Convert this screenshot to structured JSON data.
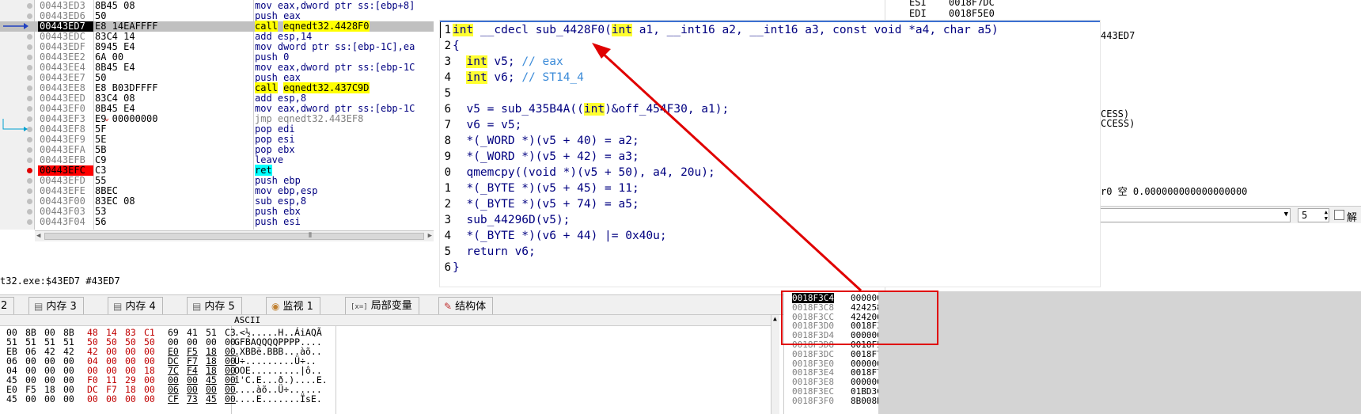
{
  "disasm": {
    "rows": [
      {
        "addr": "00443ED3",
        "bytes": "8B45 08",
        "op": "mov",
        "args": "eax,dword ptr ss:[ebp+8]",
        "kind": "mov"
      },
      {
        "addr": "00443ED6",
        "bytes": "50",
        "op": "push",
        "args": "eax",
        "kind": "push"
      },
      {
        "addr": "00443ED7",
        "bytes": "E8 14EAFFFF",
        "op": "call",
        "args": "eqnedt32.4428F0",
        "kind": "call",
        "current": true
      },
      {
        "addr": "00443EDC",
        "bytes": "83C4 14",
        "op": "add",
        "args": "esp,14",
        "kind": "add"
      },
      {
        "addr": "00443EDF",
        "bytes": "8945 E4",
        "op": "mov",
        "args": "dword ptr ss:[ebp-1C],ea",
        "kind": "mov"
      },
      {
        "addr": "00443EE2",
        "bytes": "6A 00",
        "op": "push",
        "args": "0",
        "kind": "push"
      },
      {
        "addr": "00443EE4",
        "bytes": "8B45 E4",
        "op": "mov",
        "args": "eax,dword ptr ss:[ebp-1C",
        "kind": "mov"
      },
      {
        "addr": "00443EE7",
        "bytes": "50",
        "op": "push",
        "args": "eax",
        "kind": "push"
      },
      {
        "addr": "00443EE8",
        "bytes": "E8 B03DFFFF",
        "op": "call",
        "args": "eqnedt32.437C9D",
        "kind": "call"
      },
      {
        "addr": "00443EED",
        "bytes": "83C4 08",
        "op": "add",
        "args": "esp,8",
        "kind": "add"
      },
      {
        "addr": "00443EF0",
        "bytes": "8B45 E4",
        "op": "mov",
        "args": "eax,dword ptr ss:[ebp-1C",
        "kind": "mov"
      },
      {
        "addr": "00443EF3",
        "bytes": "E9 00000000",
        "op": "jmp",
        "args": "eqnedt32.443EF8",
        "kind": "jmp"
      },
      {
        "addr": "00443EF8",
        "bytes": "5F",
        "op": "pop",
        "args": "edi",
        "kind": "pop"
      },
      {
        "addr": "00443EF9",
        "bytes": "5E",
        "op": "pop",
        "args": "esi",
        "kind": "pop"
      },
      {
        "addr": "00443EFA",
        "bytes": "5B",
        "op": "pop",
        "args": "ebx",
        "kind": "pop"
      },
      {
        "addr": "00443EFB",
        "bytes": "C9",
        "op": "leave",
        "args": "",
        "kind": "leave"
      },
      {
        "addr": "00443EFC",
        "bytes": "C3",
        "op": "ret",
        "args": "",
        "kind": "ret",
        "breakpoint": true
      },
      {
        "addr": "00443EFD",
        "bytes": "55",
        "op": "push",
        "args": "ebp",
        "kind": "push"
      },
      {
        "addr": "00443EFE",
        "bytes": "8BEC",
        "op": "mov",
        "args": "ebp,esp",
        "kind": "mov"
      },
      {
        "addr": "00443F00",
        "bytes": "83EC 08",
        "op": "sub",
        "args": "esp,8",
        "kind": "sub"
      },
      {
        "addr": "00443F03",
        "bytes": "53",
        "op": "push",
        "args": "ebx",
        "kind": "push"
      },
      {
        "addr": "00443F04",
        "bytes": "56",
        "op": "push",
        "args": "esi",
        "kind": "push"
      }
    ],
    "path_text": "t32.exe:$43ED7 #43ED7"
  },
  "registers": {
    "esi_label": "ESI",
    "esi_value": "0018F7DC",
    "edi_label": "EDI",
    "edi_value": "0018F5E0",
    "ref_addr": "443ED7",
    "access1": "CESS)",
    "access2": "CCESS)",
    "fpu_line": "r0 空 0.000000000000000000",
    "spin_value": "5",
    "check_label": "解"
  },
  "tabs": [
    {
      "label": "2",
      "icon": ""
    },
    {
      "label": "内存 3",
      "icon": "memory-icon"
    },
    {
      "label": "内存 4",
      "icon": "memory-icon"
    },
    {
      "label": "内存 5",
      "icon": "memory-icon"
    },
    {
      "label": "监视 1",
      "icon": "watch-icon"
    },
    {
      "label": "局部变量",
      "icon": "locals-icon"
    },
    {
      "label": "结构体",
      "icon": "struct-icon"
    }
  ],
  "dump": {
    "ascii_header": "ASCII",
    "rows": [
      {
        "hex": [
          "00",
          "8B",
          "00",
          "8B",
          "48",
          "14",
          "83",
          "C1",
          "69",
          "41",
          "51",
          "C3"
        ],
        "ascii": ".<½.....H..ÁiAQÃ"
      },
      {
        "hex": [
          "51",
          "51",
          "51",
          "51",
          "50",
          "50",
          "50",
          "50",
          "00",
          "00",
          "00",
          "00"
        ],
        "ascii": "GFBAQQQQPPPP...."
      },
      {
        "hex": [
          "EB",
          "06",
          "42",
          "42",
          "42",
          "00",
          "00",
          "00",
          "E0",
          "F5",
          "18",
          "00"
        ],
        "ascii": ".XBBë.BBB...àõ.."
      },
      {
        "hex": [
          "06",
          "00",
          "00",
          "00",
          "04",
          "00",
          "00",
          "00",
          "DC",
          "F7",
          "18",
          "00"
        ],
        "ascii": "Ü÷.........Ü÷.."
      },
      {
        "hex": [
          "04",
          "00",
          "00",
          "00",
          "00",
          "00",
          "00",
          "18",
          "7C",
          "F4",
          "18",
          "00"
        ],
        "ascii": "OOE.........|ô.."
      },
      {
        "hex": [
          "45",
          "00",
          "00",
          "00",
          "F0",
          "11",
          "29",
          "00",
          "00",
          "00",
          "45",
          "00"
        ],
        "ascii": "î'C.E...ð.)....E."
      },
      {
        "hex": [
          "E0",
          "F5",
          "18",
          "00",
          "DC",
          "F7",
          "18",
          "00",
          "06",
          "00",
          "00",
          "00"
        ],
        "ascii": "....àõ..Ü÷......"
      },
      {
        "hex": [
          "45",
          "00",
          "00",
          "00",
          "00",
          "00",
          "00",
          "00",
          "CF",
          "73",
          "45",
          "00"
        ],
        "ascii": "....E.......ÏsE."
      }
    ]
  },
  "stack": {
    "rows": [
      {
        "addr": "0018F3C4",
        "value": "00000000",
        "top": true
      },
      {
        "addr": "0018F3C8",
        "value": "42425800"
      },
      {
        "addr": "0018F3CC",
        "value": "424206EB"
      },
      {
        "addr": "0018F3D0",
        "value": "0018F3EC"
      },
      {
        "addr": "0018F3D4",
        "value": "000000D3"
      },
      {
        "addr": "0018F3D8",
        "value": "0018F5E0"
      },
      {
        "addr": "0018F3DC",
        "value": "0018F7DC"
      },
      {
        "addr": "0018F3E0",
        "value": "00000006"
      },
      {
        "addr": "0018F3E4",
        "value": "0018F7DC"
      },
      {
        "addr": "0018F3E8",
        "value": "000000D3"
      },
      {
        "addr": "0018F3EC",
        "value": "01BD3C05"
      },
      {
        "addr": "0018F3F0",
        "value": "8B008B00"
      }
    ]
  },
  "pseudocode": {
    "line_numbers": [
      "1",
      "2",
      "3",
      "4",
      "5",
      "6",
      "7",
      "8",
      "9",
      "0",
      "1",
      "2",
      "3",
      "4",
      "5",
      "6"
    ],
    "lines": [
      "int __cdecl sub_4428F0(int a1, __int16 a2, __int16 a3, const void *a4, char a5)",
      "{",
      "  int v5; // eax",
      "  int v6; // ST14_4",
      "",
      "  v5 = sub_435B4A((int)&off_454F30, a1);",
      "  v6 = v5;",
      "  *(_WORD *)(v5 + 40) = a2;",
      "  *(_WORD *)(v5 + 42) = a3;",
      "  qmemcpy((void *)(v5 + 50), a4, 20u);",
      "  *(_BYTE *)(v5 + 45) = 11;",
      "  *(_BYTE *)(v5 + 74) = a5;",
      "  sub_44296D(v5);",
      "  *(_BYTE *)(v6 + 44) |= 0x40u;",
      "  return v6;",
      "}"
    ]
  }
}
